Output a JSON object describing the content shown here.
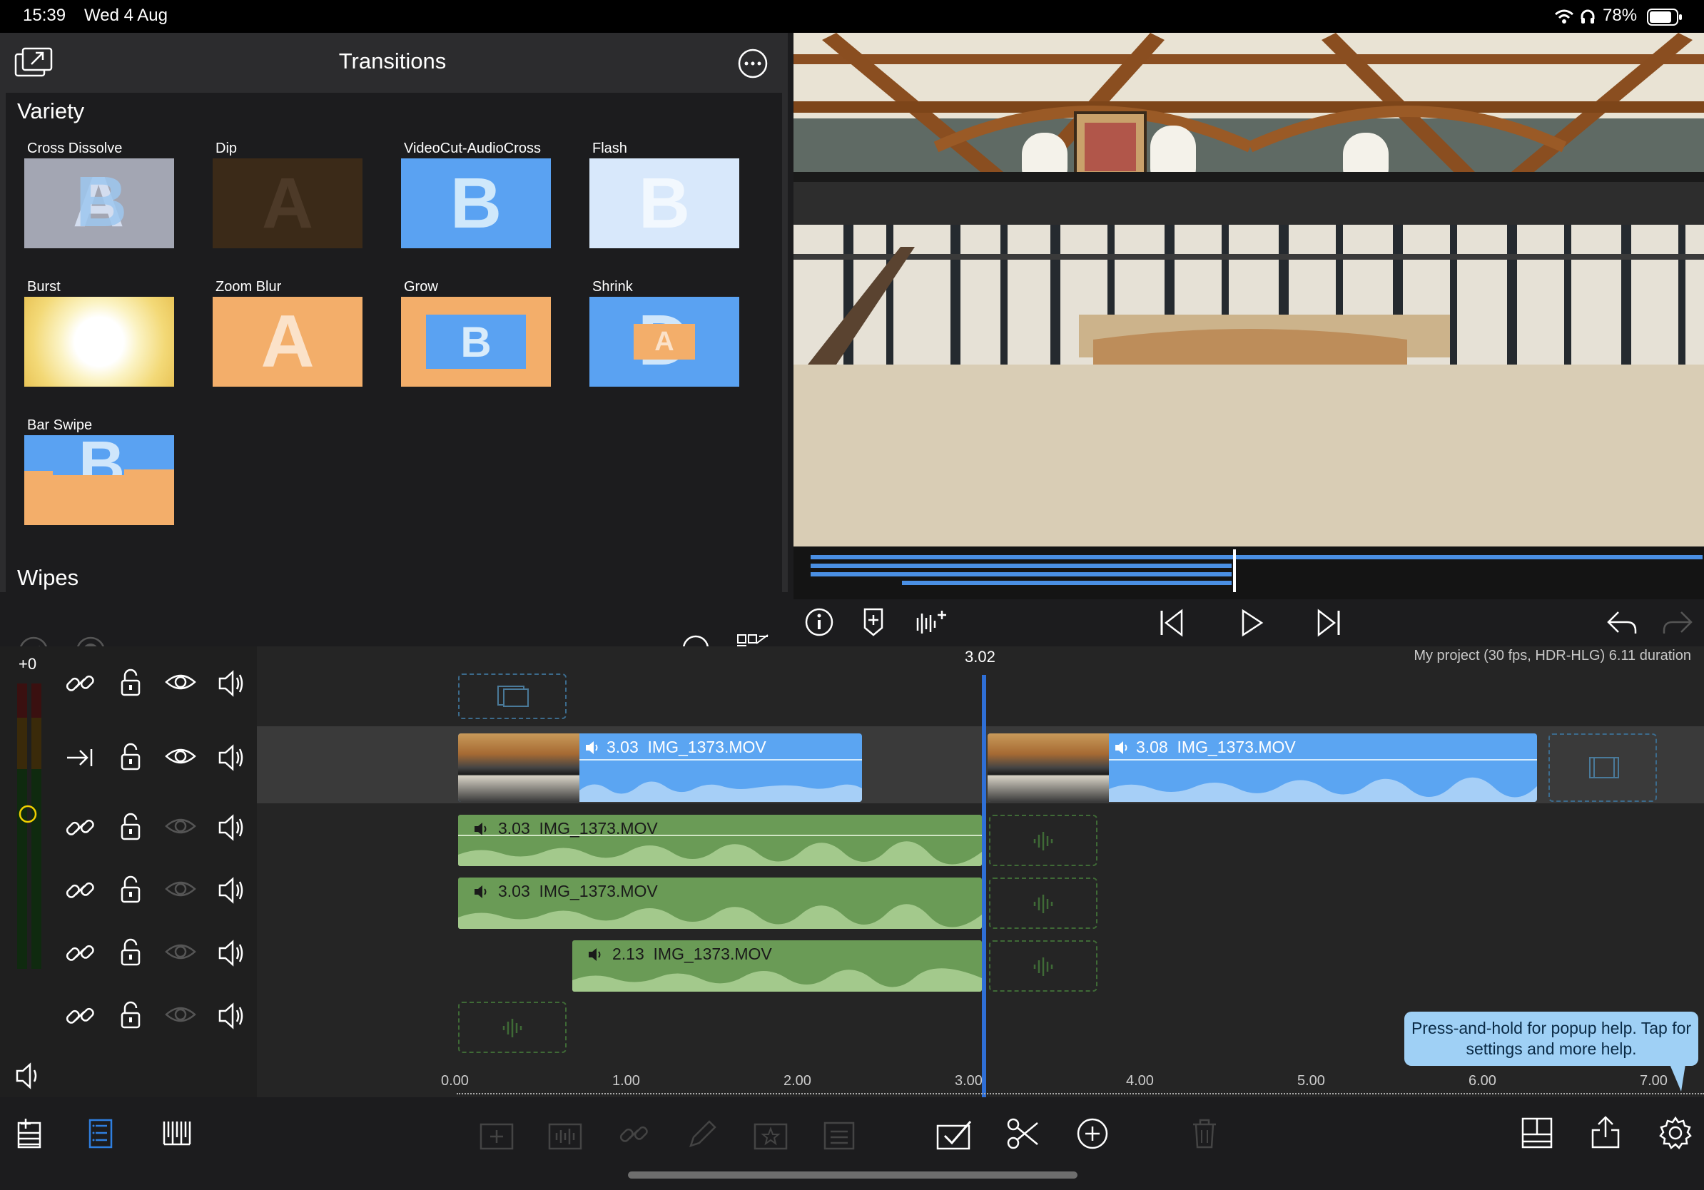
{
  "status_bar": {
    "time": "15:39",
    "date": "Wed 4 Aug",
    "battery": "78%"
  },
  "browser": {
    "title": "Transitions",
    "sections": [
      {
        "name": "Variety",
        "items": [
          {
            "label": "Cross Dissolve",
            "glyph": "B",
            "bg": "#a3a6b3",
            "fg": "#dfe6f2"
          },
          {
            "label": "Dip",
            "glyph": "A",
            "bg": "#3a2a1a",
            "fg": "#4a3828"
          },
          {
            "label": "VideoCut-AudioCross",
            "glyph": "B",
            "bg": "#5aa2f2",
            "fg": "#cfe6fb"
          },
          {
            "label": "Flash",
            "glyph": "B",
            "bg": "#d8e8fb",
            "fg": "#f1f7fe"
          },
          {
            "label": "Burst",
            "glyph": "",
            "bg": "#f7e9a0",
            "fg": "#ffffff"
          },
          {
            "label": "Zoom Blur",
            "glyph": "A",
            "bg": "#f3ae6a",
            "fg": "#fbe1c7"
          },
          {
            "label": "Grow",
            "glyph": "B",
            "bg": "#f3ae6a",
            "fg": "#d9ecfb"
          },
          {
            "label": "Shrink",
            "glyph": "A",
            "bg": "#5aa2f2",
            "fg": "#fbe1c7"
          },
          {
            "label": "Bar Swipe",
            "glyph": "B",
            "bg": "#5aa2f2",
            "fg": "#f3ae6a"
          }
        ]
      },
      {
        "name": "Wipes",
        "items": []
      }
    ]
  },
  "timeline": {
    "playhead_time": "3.02",
    "project_info": "My project (30 fps, HDR-HLG)  6.11 duration",
    "meter_label": "+0",
    "ruler": [
      "0.00",
      "1.00",
      "2.00",
      "3.00",
      "4.00",
      "5.00",
      "6.00",
      "7.00"
    ],
    "video_clips": [
      {
        "duration": "3.03",
        "name": "IMG_1373.MOV"
      },
      {
        "duration": "3.08",
        "name": "IMG_1373.MOV"
      }
    ],
    "audio_clips": [
      {
        "duration": "3.03",
        "name": "IMG_1373.MOV"
      },
      {
        "duration": "3.03",
        "name": "IMG_1373.MOV"
      },
      {
        "duration": "2.13",
        "name": "IMG_1373.MOV"
      }
    ]
  },
  "help_tip": "Press-and-hold for popup help. Tap for settings and more help.",
  "colors": {
    "accent": "#5ba5f2",
    "audio": "#6a9b56",
    "playhead": "#2f6fd6"
  }
}
